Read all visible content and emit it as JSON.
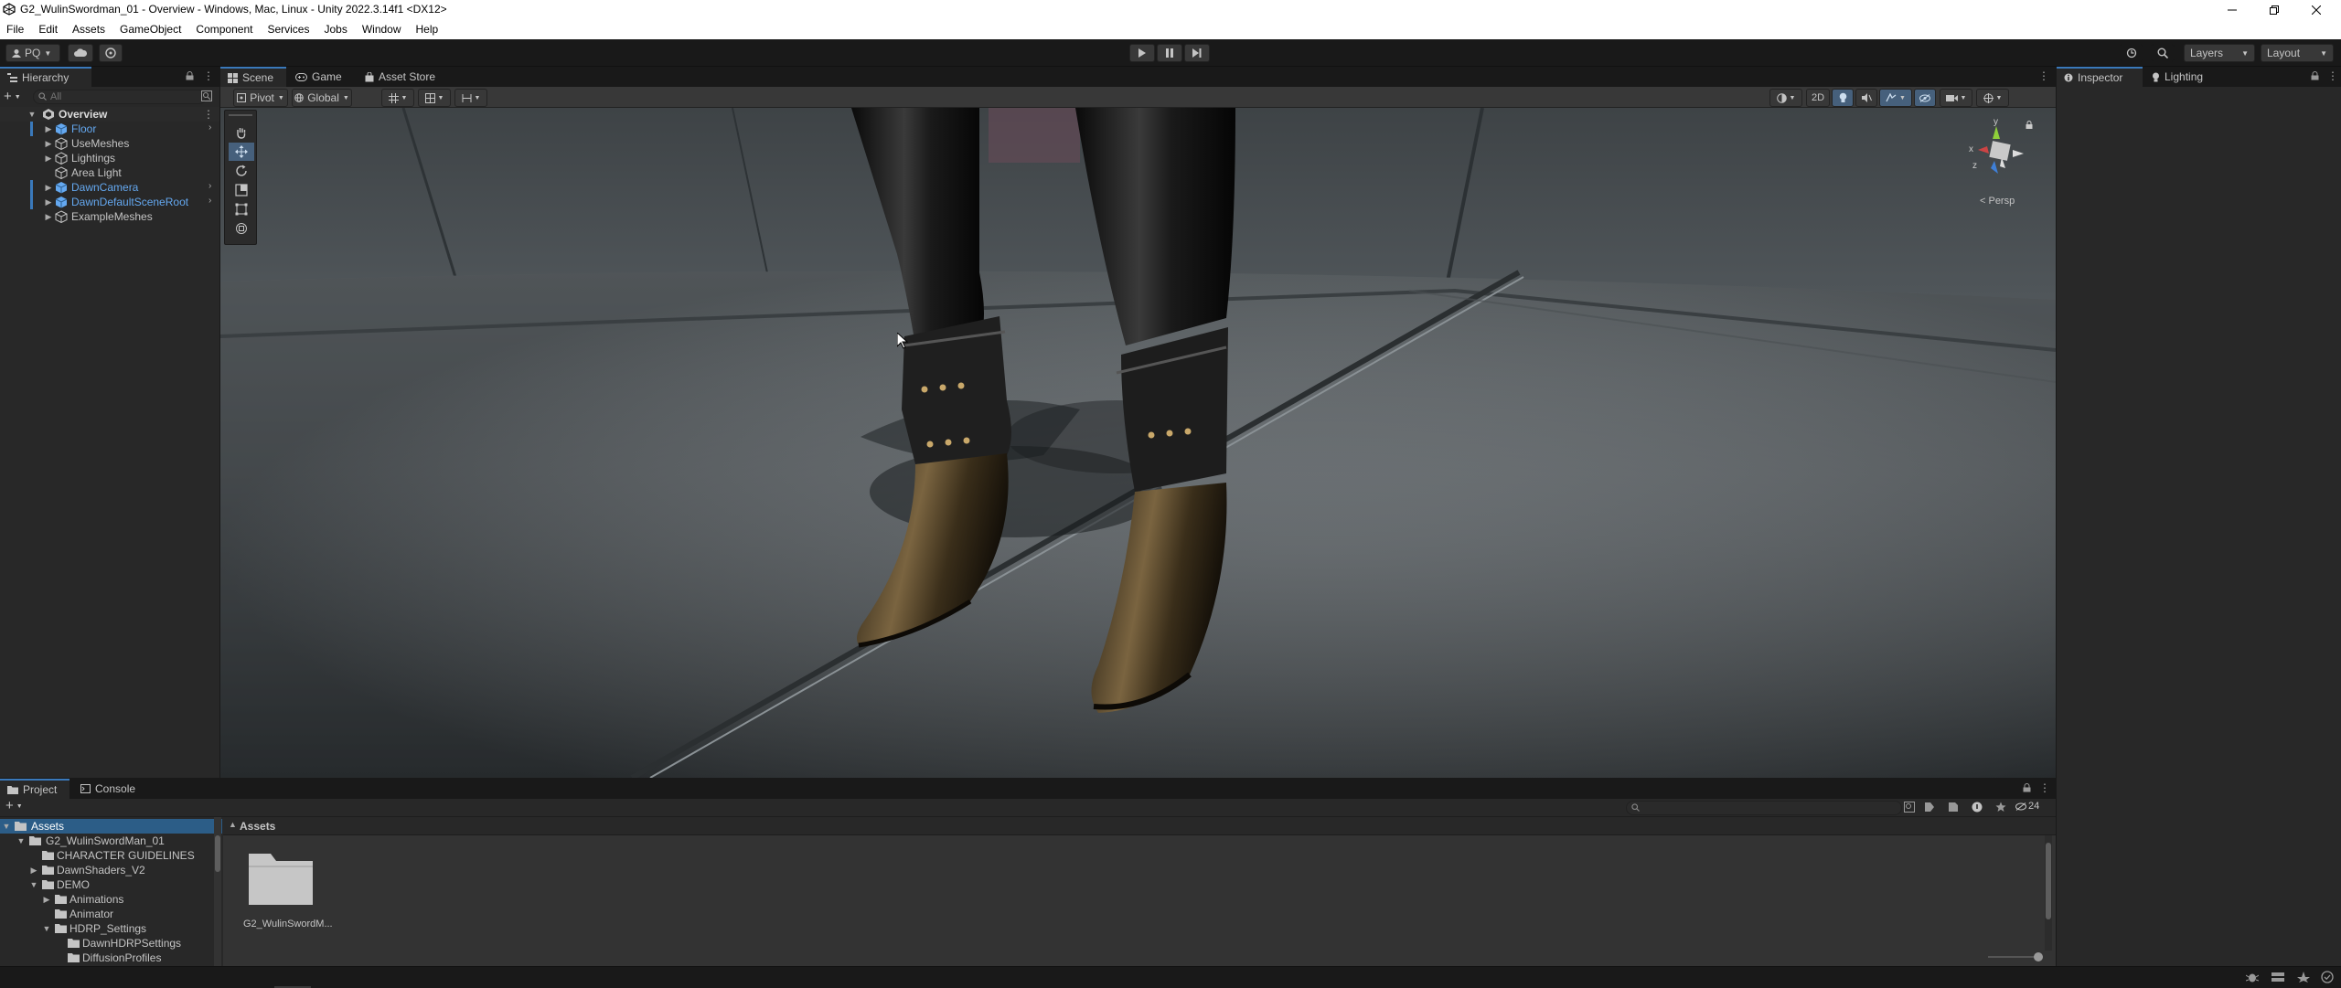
{
  "window": {
    "title": "G2_WulinSwordman_01 - Overview - Windows, Mac, Linux - Unity 2022.3.14f1 <DX12>"
  },
  "menu": [
    "File",
    "Edit",
    "Assets",
    "GameObject",
    "Component",
    "Services",
    "Jobs",
    "Window",
    "Help"
  ],
  "toolbar": {
    "account": "PQ",
    "layers": "Layers",
    "layout": "Layout"
  },
  "hierarchy": {
    "tab": "Hierarchy",
    "search_placeholder": "All",
    "scene": "Overview",
    "items": [
      {
        "label": "Floor",
        "prefab": true,
        "expandable": true
      },
      {
        "label": "UseMeshes",
        "prefab": false,
        "expandable": true
      },
      {
        "label": "Lightings",
        "prefab": false,
        "expandable": true
      },
      {
        "label": "Area Light",
        "prefab": false,
        "expandable": false
      },
      {
        "label": "DawnCamera",
        "prefab": true,
        "expandable": true
      },
      {
        "label": "DawnDefaultSceneRoot",
        "prefab": true,
        "expandable": true
      },
      {
        "label": "ExampleMeshes",
        "prefab": false,
        "expandable": true
      }
    ]
  },
  "scene_view": {
    "tabs": [
      "Scene",
      "Game",
      "Asset Store"
    ],
    "pivot": "Pivot",
    "global": "Global",
    "mode_2d": "2D",
    "persp": "< Persp",
    "gizmo_axes": {
      "y": "y",
      "x": "x",
      "z": "z"
    }
  },
  "inspector": {
    "tabs": [
      "Inspector",
      "Lighting"
    ]
  },
  "project": {
    "tabs": [
      "Project",
      "Console"
    ],
    "breadcrumb": "Assets",
    "hidden_count": "24",
    "tree": [
      {
        "label": "Assets",
        "depth": 0,
        "expanded": true
      },
      {
        "label": "G2_WulinSwordMan_01",
        "depth": 1,
        "expanded": true
      },
      {
        "label": "CHARACTER GUIDELINES",
        "depth": 2,
        "expanded": false,
        "leaf": true
      },
      {
        "label": "DawnShaders_V2",
        "depth": 2,
        "expanded": false
      },
      {
        "label": "DEMO",
        "depth": 2,
        "expanded": true
      },
      {
        "label": "Animations",
        "depth": 3,
        "expanded": false
      },
      {
        "label": "Animator",
        "depth": 3,
        "expanded": false,
        "leaf": true
      },
      {
        "label": "HDRP_Settings",
        "depth": 3,
        "expanded": true
      },
      {
        "label": "DawnHDRPSettings",
        "depth": 4,
        "expanded": false,
        "leaf": true
      },
      {
        "label": "DiffusionProfiles",
        "depth": 4,
        "expanded": false,
        "leaf": true
      }
    ],
    "grid_items": [
      {
        "label": "G2_WulinSwordM..."
      }
    ]
  },
  "colors": {
    "selection": "#2c5d87",
    "accent": "#3a79bb",
    "prefab_text": "#64a8f0"
  }
}
